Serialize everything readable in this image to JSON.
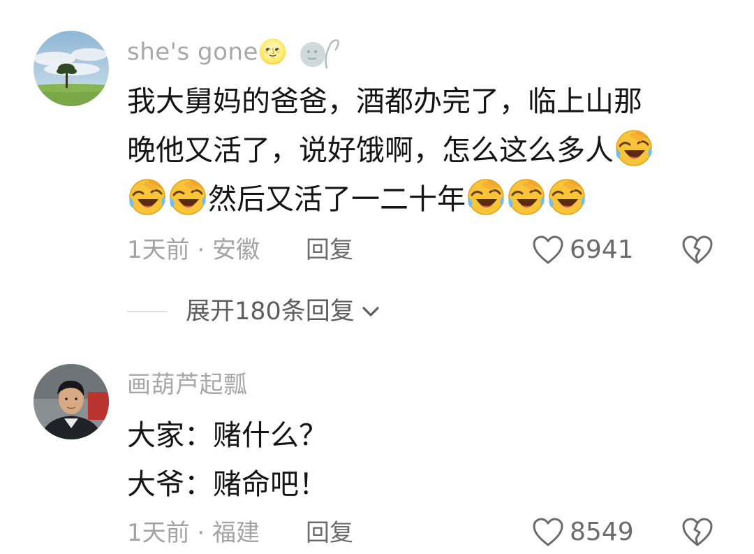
{
  "comments": [
    {
      "username": "she's  gone🌝",
      "lines": [
        {
          "text": "我大舅妈的爸爸，酒都办完了，临上山那",
          "emoji_after": 0
        },
        {
          "text": "晚他又活了，说好饿啊，怎么这么多人",
          "emoji_after": 1
        },
        {
          "emoji_before": 2,
          "text": "然后又活了一二十年",
          "emoji_after": 3
        }
      ],
      "meta": "1天前 · 安徽",
      "reply_label": "回复",
      "like_count": "6941",
      "expand_label": "展开180条回复",
      "icons": {
        "like": "heart-outline-icon",
        "dislike": "broken-heart-icon",
        "emoji": "rolling-on-floor-laughing-emoji",
        "expand": "chevron-down-icon"
      }
    },
    {
      "username": "画葫芦起瓢",
      "lines": [
        {
          "text": "大家：赌什么？"
        },
        {
          "text": "大爷：赌命吧！"
        }
      ],
      "meta": "1天前 · 福建",
      "reply_label": "回复",
      "like_count": "8549",
      "icons": {
        "like": "heart-outline-icon",
        "dislike": "broken-heart-icon"
      }
    }
  ],
  "colors": {
    "username": "#a8a8a8",
    "body": "#141414",
    "meta": "#a3a3a3",
    "action": "#6b6b6b",
    "emoji_face": "#f8c43a"
  }
}
